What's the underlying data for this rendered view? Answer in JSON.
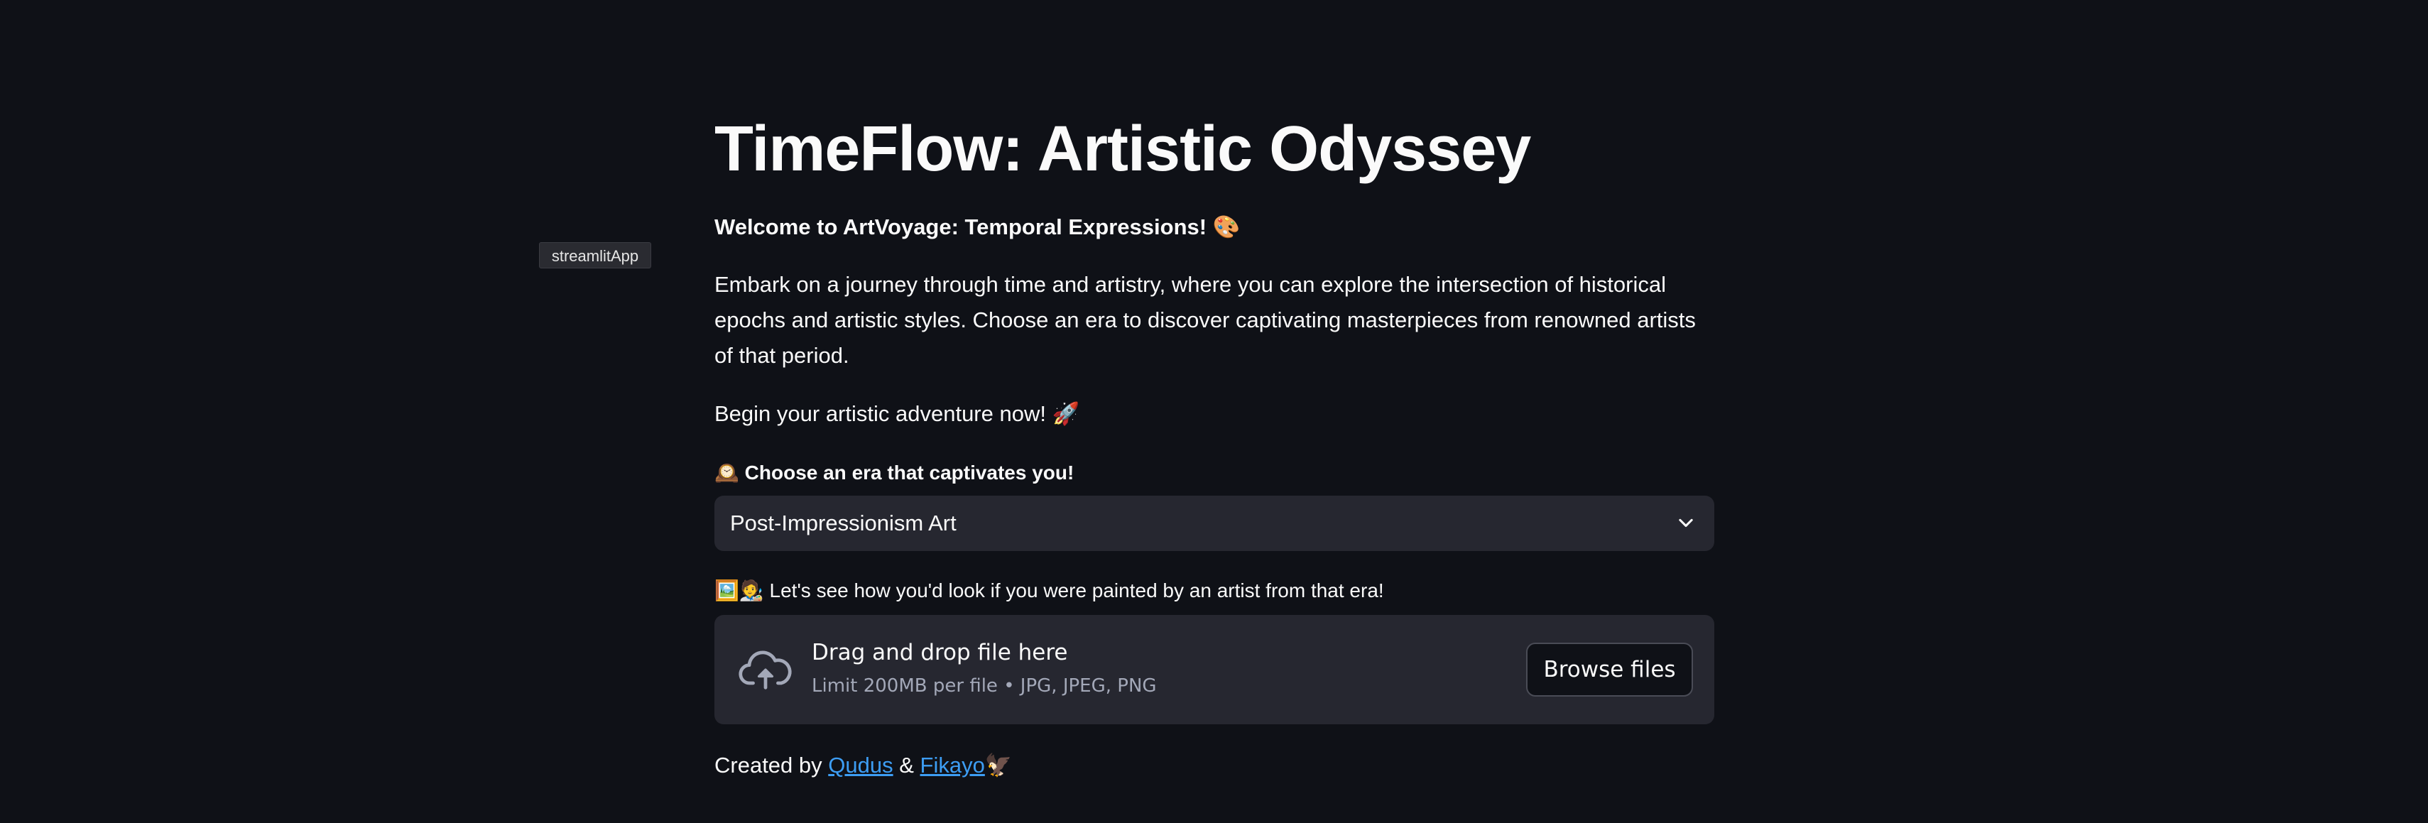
{
  "app_tag": "streamlitApp",
  "title": "TimeFlow: Artistic Odyssey",
  "welcome": {
    "text": "Welcome to ArtVoyage: Temporal Expressions!",
    "emoji": "🎨"
  },
  "intro": "Embark on a journey through time and artistry, where you can explore the intersection of historical epochs and artistic styles. Choose an era to discover captivating masterpieces from renowned artists of that period.",
  "begin": {
    "text": "Begin your artistic adventure now!",
    "emoji": "🚀"
  },
  "era_select": {
    "emoji": "🕰️",
    "label": "Choose an era that captivates you!",
    "selected": "Post-Impressionism Art",
    "icon": "chevron-down-icon"
  },
  "uploader": {
    "emoji": "🖼️🧑‍🎨",
    "label": "Let's see how you'd look if you were painted by an artist from that era!",
    "drop_title": "Drag and drop file here",
    "drop_sub": "Limit 200MB per file • JPG, JPEG, PNG",
    "browse_label": "Browse files",
    "icon": "cloud-upload-icon"
  },
  "footer": {
    "prefix": "Created by",
    "author1": "Qudus",
    "separator": "&",
    "author2": "Fikayo",
    "emoji": "🦅"
  },
  "colors": {
    "background": "#0f1117",
    "surface": "#262730",
    "text": "#fafafa",
    "muted": "#a3a8b8",
    "link": "#3d9df3"
  }
}
